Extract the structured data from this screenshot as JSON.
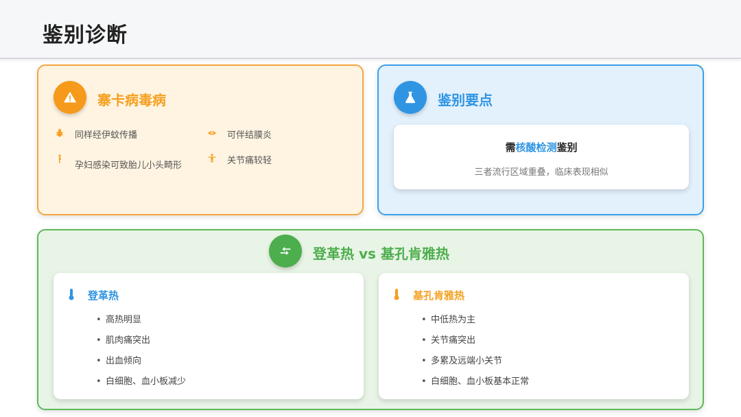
{
  "page": {
    "title": "鉴别诊断"
  },
  "zika": {
    "title": "寨卡病毒病",
    "features": [
      {
        "text": "同样经伊蚊传播",
        "icon": "bug-icon"
      },
      {
        "text": "可伴结膜炎",
        "icon": "eye-icon"
      },
      {
        "text": "孕妇感染可致胎儿小头畸形",
        "icon": "pregnant-woman-icon"
      },
      {
        "text": "关节痛较轻",
        "icon": "person-icon"
      }
    ],
    "color": "#f5a020"
  },
  "keypoint": {
    "title": "鉴别要点",
    "headline_pre": "需",
    "headline_em": "核酸检测",
    "headline_post": "鉴别",
    "note": "三者流行区域重叠，临床表现相似",
    "color": "#2f95e3"
  },
  "compare": {
    "title": "登革热 vs 基孔肯雅热",
    "color": "#4cae4c",
    "dengue": {
      "title": "登革热",
      "items": [
        "高热明显",
        "肌肉痛突出",
        "出血倾向",
        "白细胞、血小板减少"
      ],
      "color": "#2f95e3"
    },
    "chik": {
      "title": "基孔肯雅热",
      "items": [
        "中低热为主",
        "关节痛突出",
        "多累及远端小关节",
        "白细胞、血小板基本正常"
      ],
      "color": "#f5a020"
    },
    "bullet": "•"
  }
}
